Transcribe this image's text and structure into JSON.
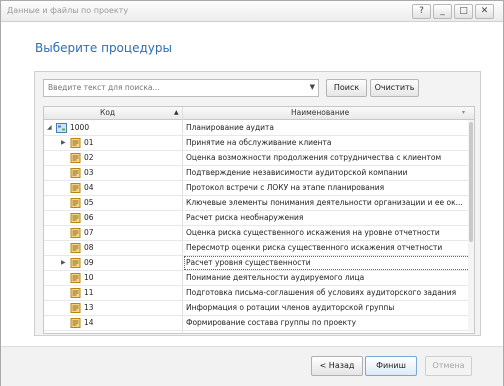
{
  "window": {
    "title": "Данные и файлы по проекту",
    "buttons": [
      "?",
      "_",
      "□",
      "✕"
    ]
  },
  "heading": "Выберите процедуры",
  "search": {
    "placeholder": "Введите текст для поиска...",
    "find_label": "Поиск",
    "clear_label": "Очистить"
  },
  "grid": {
    "columns": {
      "code": "Код",
      "name": "Наименование"
    },
    "rows": [
      {
        "code": "1000",
        "name": "Планирование аудита",
        "level": 0,
        "expander": "collapse"
      },
      {
        "code": "01",
        "name": "Принятие на обслуживание клиента",
        "level": 1,
        "expander": "expand"
      },
      {
        "code": "02",
        "name": "Оценка возможности продолжения сотрудничества с клиентом",
        "level": 1,
        "expander": ""
      },
      {
        "code": "03",
        "name": "Подтверждение независимости аудиторской компании",
        "level": 1,
        "expander": ""
      },
      {
        "code": "04",
        "name": "Протокол встречи с ЛОКУ на этапе планирования",
        "level": 1,
        "expander": ""
      },
      {
        "code": "05",
        "name": "Ключевые элементы понимания деятельности организации и ее ок...",
        "level": 1,
        "expander": ""
      },
      {
        "code": "06",
        "name": "Расчет риска необнаружения",
        "level": 1,
        "expander": ""
      },
      {
        "code": "07",
        "name": "Оценка риска существенного искажения на уровне отчетности",
        "level": 1,
        "expander": ""
      },
      {
        "code": "08",
        "name": "Пересмотр оценки риска существенного искажения отчетности",
        "level": 1,
        "expander": ""
      },
      {
        "code": "09",
        "name": "Расчет уровня существенности",
        "level": 1,
        "expander": "expand",
        "selected": true
      },
      {
        "code": "10",
        "name": "Понимание деятельности аудируемого лица",
        "level": 1,
        "expander": ""
      },
      {
        "code": "11",
        "name": "Подготовка письма-соглашения об условиях аудиторского задания",
        "level": 1,
        "expander": ""
      },
      {
        "code": "13",
        "name": "Информация о ротации членов аудиторской группы",
        "level": 1,
        "expander": ""
      },
      {
        "code": "14",
        "name": "Формирование состава группы по проекту",
        "level": 1,
        "expander": ""
      }
    ]
  },
  "footer": {
    "back_label": "< Назад",
    "finish_label": "Финиш",
    "cancel_label": "Отмена"
  }
}
